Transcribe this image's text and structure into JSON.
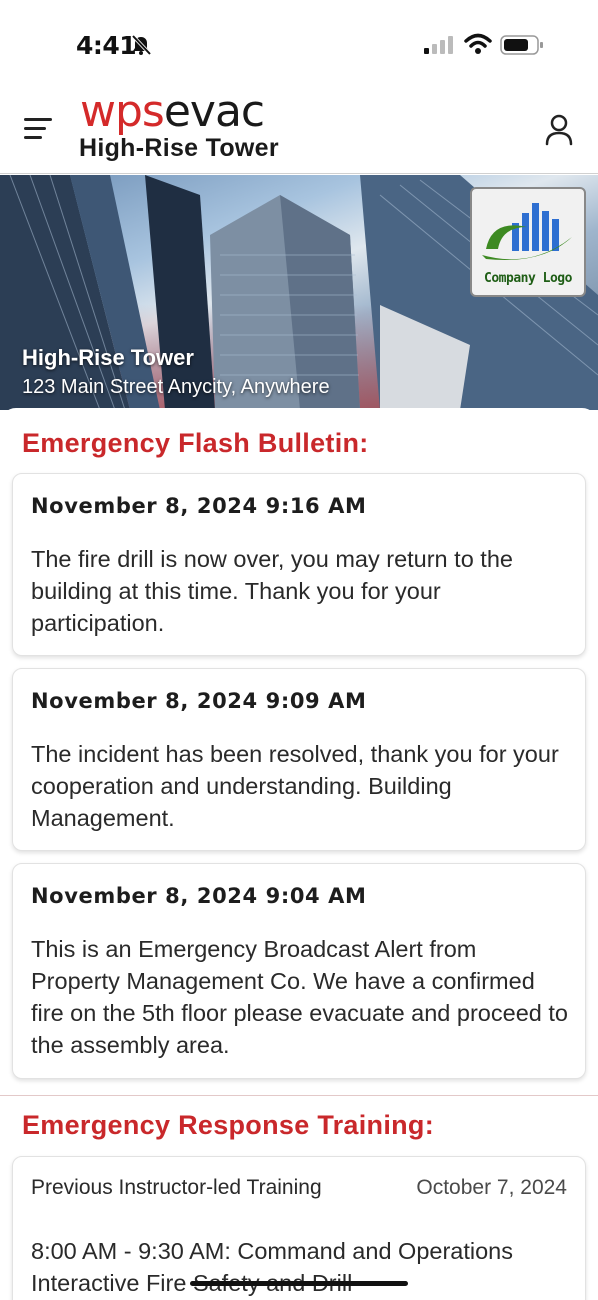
{
  "status_bar": {
    "time": "4:41"
  },
  "header": {
    "logo_wps": "wps",
    "logo_evac": "evac",
    "building_name": "High-Rise Tower"
  },
  "hero": {
    "name": "High-Rise Tower",
    "address": "123 Main Street Anycity, Anywhere",
    "company_logo_text": "Company Logo"
  },
  "bulletin": {
    "title": "Emergency Flash Bulletin:",
    "items": [
      {
        "date": "November 8, 2024 9:16 AM",
        "text": "The fire drill is now over, you may return to the building at this time. Thank you for your participation."
      },
      {
        "date": "November 8, 2024 9:09 AM",
        "text": "The incident has been resolved, thank you for your cooperation and understanding. Building Management."
      },
      {
        "date": "November 8, 2024 9:04 AM",
        "text": "This is an Emergency Broadcast Alert from Property Management Co. We have a confirmed fire on the 5th floor please evacuate and proceed to the assembly area."
      }
    ]
  },
  "training": {
    "title": "Emergency Response Training:",
    "item": {
      "label": "Previous Instructor-led Training",
      "date": "October 7, 2024",
      "description": "8:00 AM - 9:30 AM: Command and Operations Interactive Fire Safety and Drill"
    }
  },
  "colors": {
    "brand_red": "#c9282b",
    "logo_red": "#d42a2a"
  }
}
